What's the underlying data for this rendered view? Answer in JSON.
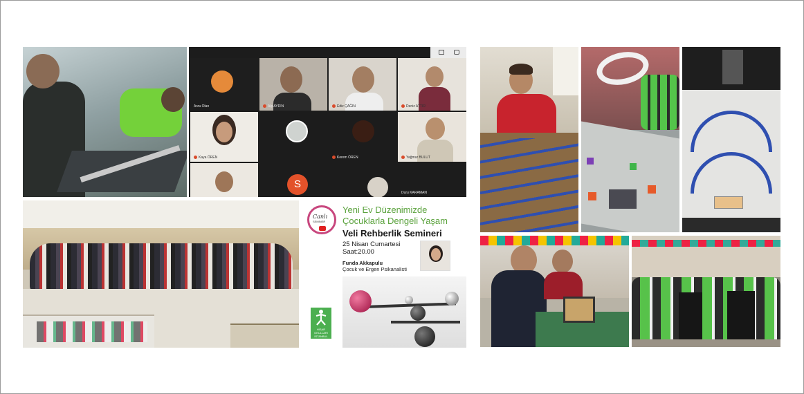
{
  "collage": {
    "left_photos": {
      "robot_build": "students building a robot",
      "group_photo": "large student group photo"
    },
    "video_call": {
      "toolbar_icons": [
        "grid-icon",
        "layout-icon"
      ],
      "participants": [
        {
          "name": "Arzu Olan"
        },
        {
          "name": "Alp AYDIN"
        },
        {
          "name": "Ediz ÇAĞIN"
        },
        {
          "name": "Deniz ATTIR"
        },
        {
          "name": "Kaya ÖREN"
        },
        {
          "name": "Kerem ÖREN"
        },
        {
          "name": "Yağmur BULUT"
        },
        {
          "name": "Duru KARAMAN"
        }
      ],
      "avatar_letter": "S"
    },
    "poster": {
      "badge_word": "Canlı",
      "badge_sub": "SEMİNER",
      "title": "Yeni Ev Düzenimizde Çocuklarla Dengeli Yaşam",
      "subtitle": "Veli Rehberlik Semineri",
      "date": "25 Nisan Cumartesi",
      "time": "Saat:20.00",
      "speaker_name": "Funda Akkapulu",
      "speaker_title": "Çocuk ve Ergen Psikanalisti",
      "school_name": "HİSAR OKULLARI",
      "school_city": "İSTANBUL"
    }
  },
  "colors": {
    "poster_green": "#5aa23c",
    "badge_pink": "#c8477e",
    "call_avatar": "#e3522a"
  }
}
